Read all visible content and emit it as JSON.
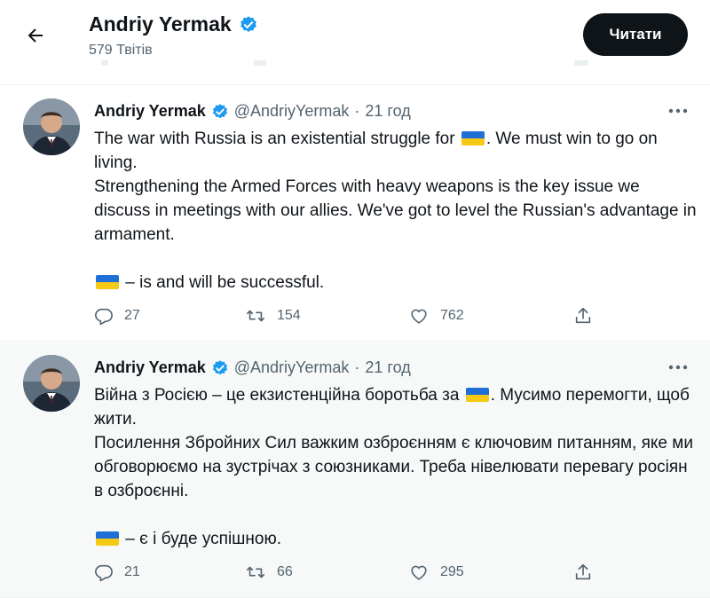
{
  "header": {
    "name": "Andriy Yermak",
    "tweet_count": "579 Твітів",
    "follow_label": "Читати"
  },
  "tweets": [
    {
      "name": "Andriy Yermak",
      "handle": "@AndriyYermak",
      "dot": "·",
      "time": "21 год",
      "line1_before_flag": "The war with Russia is an existential struggle for ",
      "line1_after_flag": ". We must win to go on living.",
      "line2": "Strengthening the Armed Forces with heavy weapons is the key issue we discuss in meetings with our allies. We've got to level the Russian's advantage in armament.",
      "line3_after_flag": " – is and will be successful.",
      "replies": "27",
      "retweets": "154",
      "likes": "762"
    },
    {
      "name": "Andriy Yermak",
      "handle": "@AndriyYermak",
      "dot": "·",
      "time": "21 год",
      "line1_before_flag": "Війна з Росією – це екзистенційна боротьба за ",
      "line1_after_flag": ". Мусимо перемогти, щоб жити.",
      "line2": "Посилення Збройних Сил важким озброєнням є ключовим питанням, яке ми обговорюємо на зустрічах з союзниками. Треба нівелювати перевагу росіян в озброєнні.",
      "line3_after_flag": " – є і буде успішною.",
      "replies": "21",
      "retweets": "66",
      "likes": "295"
    }
  ],
  "icons": {
    "back": "arrow-left-icon",
    "verified": "verified-badge-icon",
    "more": "more-horizontal-icon",
    "reply": "reply-icon",
    "retweet": "retweet-icon",
    "like": "heart-icon",
    "share": "share-icon",
    "flag": "ukraine-flag-emoji"
  },
  "colors": {
    "verified": "#1d9bf0",
    "text": "#0f1419",
    "muted": "#536471",
    "follow_bg": "#0f1419"
  }
}
